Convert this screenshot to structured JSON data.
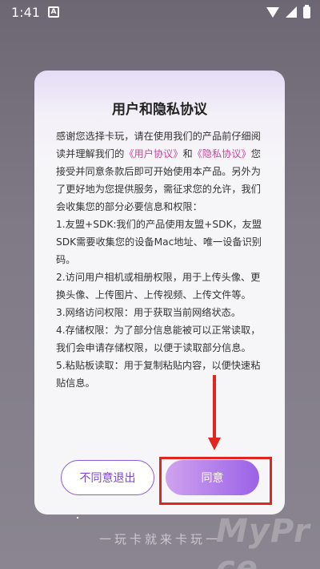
{
  "status_bar": {
    "time": "1:41",
    "notification_icon": "A"
  },
  "dialog": {
    "title": "用户和隐私协议",
    "body": {
      "intro_pre": "感谢您选择卡玩，请在使用我们的产品前仔细阅读并理解我们的",
      "user_agreement_link": "《用户协议》",
      "and": "和",
      "privacy_link": "《隐私协议》",
      "intro_post": "您接受并同意条款后即可开始使用本产品。另外为了更好地为您提供服务，需征求您的允许，我们会收集您的部分必要信息和权限：",
      "items": [
        "1.友盟+SDK:我们的产品使用友盟+SDK，友盟SDK需要收集您的设备Mac地址、唯一设备识别码。",
        "2.访问用户相机或相册权限，用于上传头像、更换头像、上传图片、上传视频、上传文件等。",
        "3.网络访问权限：用于获取当前网络状态。",
        "4.存储权限：为了部分信息能被可以正常读取，我们会申请存储权限，以便于读取部分信息。",
        "5.粘贴板读取：用于复制粘贴内容，以便快速粘贴信息。"
      ]
    },
    "decline_label": "不同意退出",
    "agree_label": "同意"
  },
  "slogan": "一玩卡就来卡玩一",
  "watermark": "MyPr ce",
  "colors": {
    "accent": "#9a62e6",
    "link": "#c04a9a",
    "highlight": "#e0261f"
  }
}
